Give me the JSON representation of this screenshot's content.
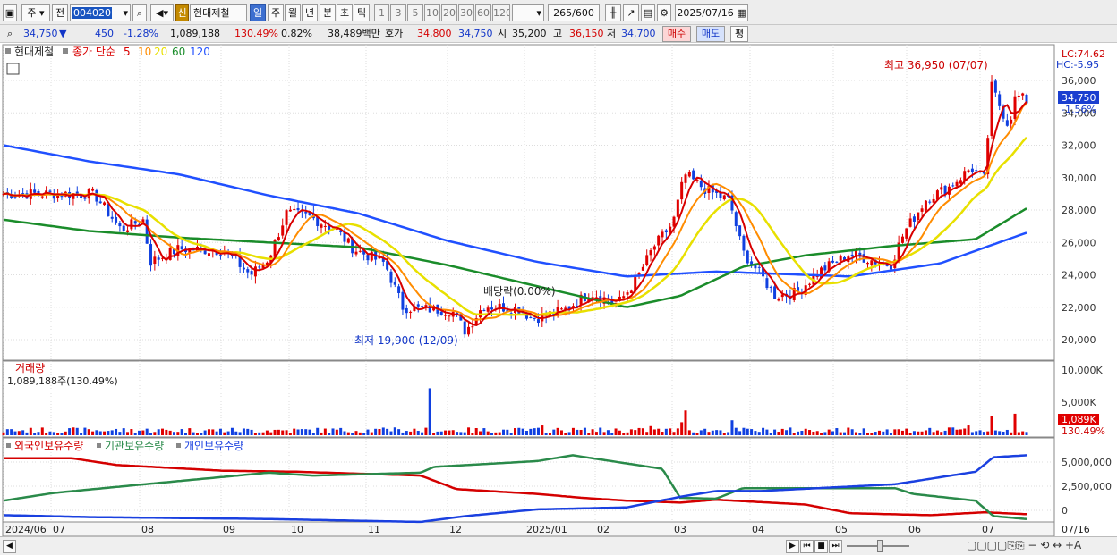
{
  "toolbar": {
    "market": "주",
    "prev_label": "전",
    "code": "004020",
    "new_badge": "신",
    "stock_name": "현대제철",
    "periods": [
      "일",
      "주",
      "월",
      "년",
      "분",
      "초",
      "틱"
    ],
    "active_period": "일",
    "minutes": [
      "1",
      "3",
      "5",
      "10",
      "20",
      "30",
      "60",
      "120"
    ],
    "count": "265",
    "count_total": "/600",
    "date": "2025/07/16"
  },
  "quote": {
    "price": "34,750",
    "change": "450",
    "change_pct": "-1.28%",
    "volume": "1,089,188",
    "vol_ratio": "130.49%",
    "turnover": "0.82%",
    "amount": "38,489백만",
    "ask_label": "호가",
    "ask": "34,800",
    "bid": "34,750",
    "open_label": "시",
    "open": "35,200",
    "high_label": "고",
    "high": "36,150",
    "low_label": "저",
    "low": "34,700",
    "buy_label": "매수",
    "sell_label": "매도",
    "avg_label": "평"
  },
  "chart": {
    "legend_name": "현대제철",
    "legend_series": "종가 단순",
    "ma_periods": [
      "5",
      "10",
      "20",
      "60",
      "120"
    ],
    "lc": "LC:74.62",
    "hc": "HC:-5.95",
    "high_annot": "최고 36,950 (07/07)",
    "low_annot": "최저 19,900 (12/09)",
    "dividend_annot": "배당락(0.00%)",
    "price_tag": "34,750",
    "pct_tag": "-1.56%",
    "price_axis": [
      "36,000",
      "34,000",
      "32,000",
      "30,000",
      "28,000",
      "26,000",
      "24,000",
      "22,000",
      "20,000"
    ],
    "volume_title": "거래량",
    "volume_info": "1,089,188주(130.49%)",
    "volume_axis": [
      "10,000K",
      "5,000K"
    ],
    "volume_tag": "1,089K",
    "volume_pct_tag": "130.49%",
    "holdings_legend": [
      "외국인보유수량",
      "기관보유수량",
      "개인보유수량"
    ],
    "holdings_axis": [
      "5,000,000",
      "2,500,000",
      "0"
    ],
    "date_axis": [
      "2024/06",
      "07",
      "08",
      "09",
      "10",
      "11",
      "12",
      "2025/01",
      "02",
      "03",
      "04",
      "05",
      "06",
      "07"
    ],
    "right_date": "07/16"
  },
  "colors": {
    "up": "#e00000",
    "down": "#1040e0",
    "ma5": "#d80000",
    "ma10": "#ff8c00",
    "ma20": "#e8e000",
    "ma60": "#1a8c2a",
    "ma120": "#2050ff"
  }
}
